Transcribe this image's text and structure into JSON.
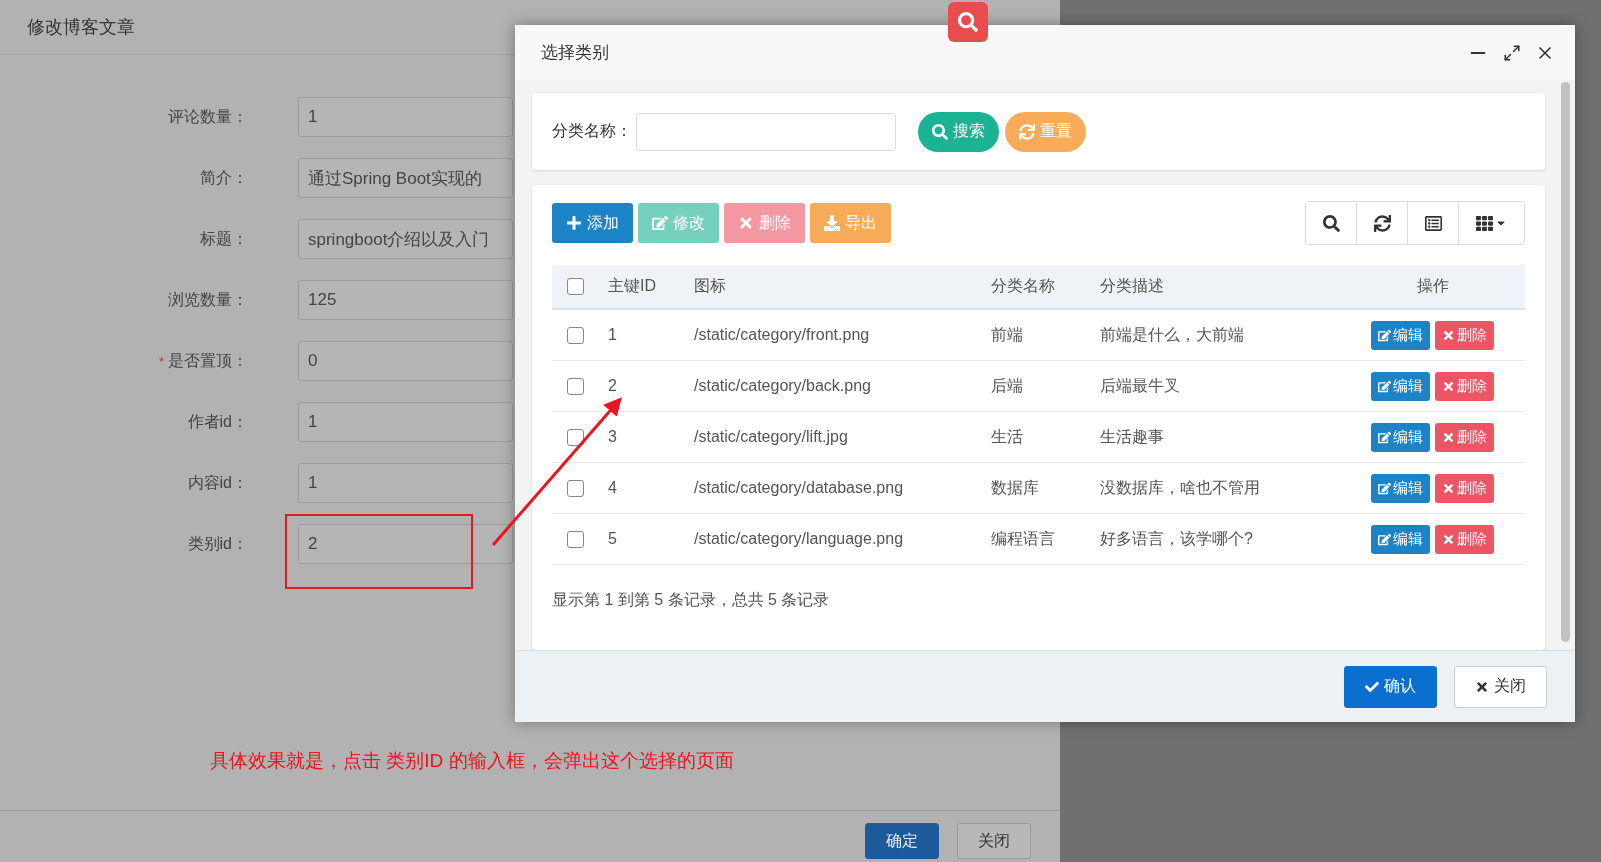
{
  "background_form": {
    "title": "修改博客文章",
    "fields": [
      {
        "label": "评论数量：",
        "value": "1",
        "annotated": false
      },
      {
        "label": "简介：",
        "value": "通过Spring Boot实现的",
        "annotated": false
      },
      {
        "label": "标题：",
        "value": "springboot介绍以及入门",
        "annotated": false
      },
      {
        "label": "浏览数量：",
        "value": "125",
        "annotated": false
      },
      {
        "label": "是否置顶：",
        "value": "0",
        "required_mark": "*",
        "annotated": false
      },
      {
        "label": "作者id：",
        "value": "1",
        "annotated": false
      },
      {
        "label": "内容id：",
        "value": "1",
        "annotated": false
      },
      {
        "label": "类别id：",
        "value": "2",
        "annotated": true
      }
    ],
    "annotation": "具体效果就是，点击 类别ID 的输入框，会弹出这个选择的页面",
    "buttons": [
      {
        "label": "确定",
        "kind": "primary"
      },
      {
        "label": "关闭",
        "kind": "default"
      }
    ]
  },
  "dialog": {
    "title": "选择类别",
    "search": {
      "label": "分类名称：",
      "buttons": [
        {
          "label": "搜索",
          "kind": "search"
        },
        {
          "label": "重置",
          "kind": "reset"
        }
      ]
    },
    "toolbar": [
      {
        "label": "添加",
        "kind": "add",
        "disabled": false
      },
      {
        "label": "修改",
        "kind": "edit",
        "disabled": true
      },
      {
        "label": "删除",
        "kind": "delete",
        "disabled": true
      },
      {
        "label": "导出",
        "kind": "export",
        "disabled": false
      }
    ],
    "table": {
      "select_all_checked": false,
      "columns": [
        "主键ID",
        "图标",
        "分类名称",
        "分类描述",
        "操作"
      ],
      "rows": [
        {
          "checked": false,
          "cells": [
            "1",
            "/static/category/front.png",
            "前端",
            "前端是什么，大前端"
          ],
          "actions": [
            {
              "label": "编辑",
              "kind": "edit"
            },
            {
              "label": "删除",
              "kind": "delete"
            }
          ]
        },
        {
          "checked": false,
          "cells": [
            "2",
            "/static/category/back.png",
            "后端",
            "后端最牛叉"
          ],
          "actions": [
            {
              "label": "编辑",
              "kind": "edit"
            },
            {
              "label": "删除",
              "kind": "delete"
            }
          ]
        },
        {
          "checked": false,
          "cells": [
            "3",
            "/static/category/lift.jpg",
            "生活",
            "生活趣事"
          ],
          "actions": [
            {
              "label": "编辑",
              "kind": "edit"
            },
            {
              "label": "删除",
              "kind": "delete"
            }
          ]
        },
        {
          "checked": false,
          "cells": [
            "4",
            "/static/category/database.png",
            "数据库",
            "没数据库，啥也不管用"
          ],
          "actions": [
            {
              "label": "编辑",
              "kind": "edit"
            },
            {
              "label": "删除",
              "kind": "delete"
            }
          ]
        },
        {
          "checked": false,
          "cells": [
            "5",
            "/static/category/language.png",
            "编程语言",
            "好多语言，该学哪个?"
          ],
          "actions": [
            {
              "label": "编辑",
              "kind": "edit"
            },
            {
              "label": "删除",
              "kind": "delete"
            }
          ]
        }
      ]
    },
    "pagination_info": "显示第 1 到第 5 条记录，总共 5 条记录",
    "footer_buttons": [
      {
        "label": "确认",
        "kind": "confirm"
      },
      {
        "label": "关闭",
        "kind": "close"
      }
    ]
  }
}
